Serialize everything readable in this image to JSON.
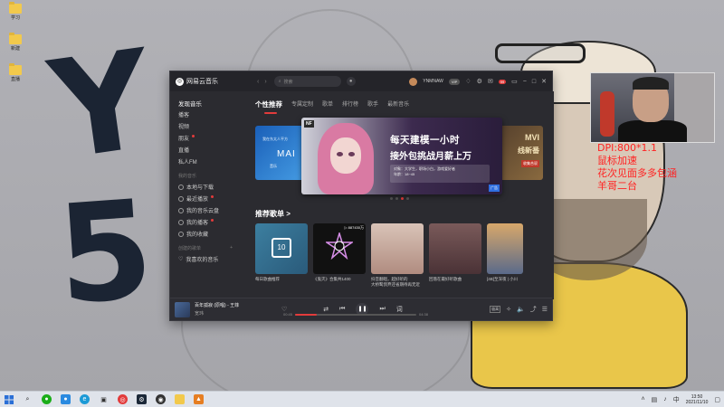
{
  "desktop": {
    "icons": [
      {
        "label": "学习"
      },
      {
        "label": "新建"
      },
      {
        "label": "直播"
      }
    ]
  },
  "app": {
    "name": "网易云音乐",
    "search_placeholder": "搜索",
    "username": "YNMNAW",
    "vip_label": "VIP",
    "message_badge": "99",
    "sidebar": {
      "items": [
        {
          "label": "发现音乐",
          "active": true
        },
        {
          "label": "播客"
        },
        {
          "label": "视频"
        },
        {
          "label": "朋友",
          "dot": true
        },
        {
          "label": "直播"
        },
        {
          "label": "私人FM"
        }
      ],
      "my_music_title": "我的音乐",
      "my_music": [
        {
          "label": "本地与下载"
        },
        {
          "label": "最近播放",
          "dot": true
        },
        {
          "label": "我的音乐云盘"
        },
        {
          "label": "我的播客",
          "dot": true
        },
        {
          "label": "我的收藏"
        }
      ],
      "created_title": "创建的歌单",
      "created_add": "+",
      "liked_playlist": "我喜欢的音乐"
    },
    "tabs": [
      {
        "label": "个性推荐",
        "active": true
      },
      {
        "label": "专属定制"
      },
      {
        "label": "歌单"
      },
      {
        "label": "排行榜"
      },
      {
        "label": "歌手"
      },
      {
        "label": "最新音乐"
      }
    ],
    "banner_left": {
      "line1": "我在东太人平方",
      "line2": "MAI",
      "line3": "音乐"
    },
    "banner_right": {
      "line1": "MVI",
      "line2": "线新番",
      "line3": "收集合驭"
    },
    "ad": {
      "logo": "NF",
      "title": "每天建模一小时",
      "subtitle": "接外包挑战月薪上万",
      "box_line1": "对象：大学生，职场小白，游戏爱好者",
      "box_line2": "年龄：18~45",
      "tag": "广告"
    },
    "recommend_title": "推荐歌单 >",
    "playlists": [
      {
        "caption": "每日歌曲推荐",
        "caption2": "",
        "count": "",
        "cover_text": "10"
      },
      {
        "caption": "《鬼灭》合集共1400",
        "caption2": "",
        "count": "▷ 887430万",
        "cover_text": ""
      },
      {
        "caption": "抖音翻唱，超好听的",
        "caption2": "大桥鹭鸽弃还省期待再无近",
        "count": "",
        "cover_text": ""
      },
      {
        "caption": "回落在最好听歌曲",
        "caption2": "",
        "count": "",
        "cover_text": ""
      },
      {
        "caption": "[4B]至深夜 | 小川",
        "caption2": "",
        "count": "",
        "cover_text": ""
      }
    ],
    "player": {
      "title": "百年孤寂 (原唱) - 王菲",
      "artist": "宽玮",
      "time_current": "00:45",
      "time_total": "04:38",
      "progress": 0.18,
      "quality": "极高"
    }
  },
  "overlay": {
    "lines": [
      "DPI:800*1.1",
      "鼠标加速",
      "花次见面多多包涵",
      "羊哥二台"
    ]
  },
  "taskbar": {
    "time": "13:50",
    "date": "2021/11/10"
  }
}
